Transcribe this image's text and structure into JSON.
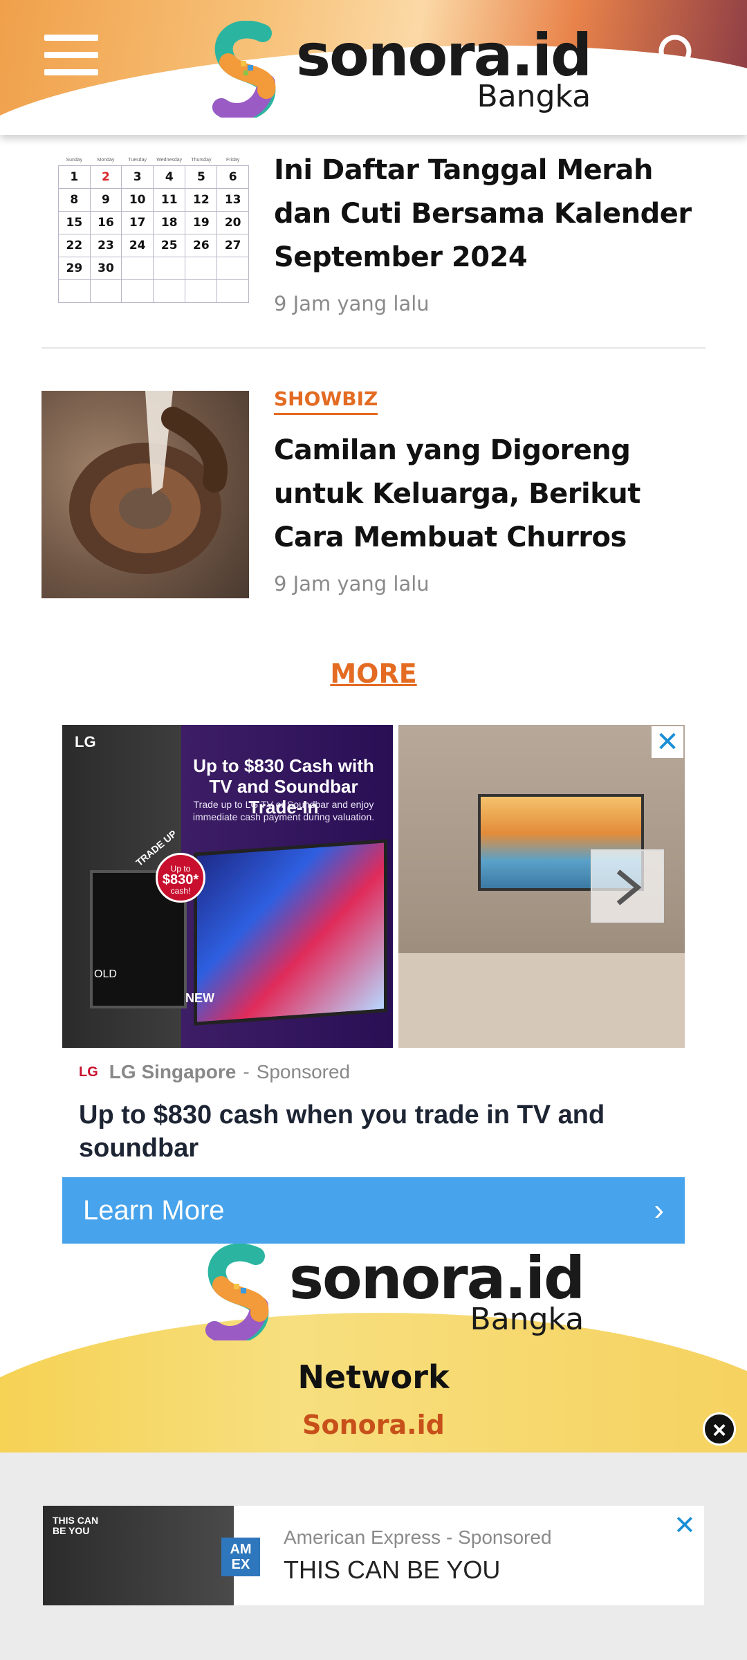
{
  "header": {
    "brand": "sonora.id",
    "city": "Bangka"
  },
  "articles": [
    {
      "category": "",
      "title": "Ini Daftar Tanggal Merah dan Cuti Bersama Kalender September 2024",
      "time": "9 Jam yang lalu"
    },
    {
      "category": "SHOWBIZ",
      "title": "Camilan yang Digoreng untuk Keluarga, Berikut Cara Membuat Churros",
      "time": "9 Jam yang lalu"
    }
  ],
  "calendar": {
    "rows": [
      [
        "1",
        "2",
        "3",
        "4",
        "5",
        "6"
      ],
      [
        "8",
        "9",
        "10",
        "11",
        "12",
        "13"
      ],
      [
        "15",
        "16",
        "17",
        "18",
        "19",
        "20"
      ],
      [
        "22",
        "23",
        "24",
        "25",
        "26",
        "27"
      ],
      [
        "29",
        "30",
        "",
        "",
        "",
        ""
      ],
      [
        "",
        "",
        "",
        "",
        "",
        ""
      ]
    ]
  },
  "more_label": "MORE",
  "ad": {
    "image_brand": "LG",
    "image_headline": "Up to $830 Cash with TV and Soundbar Trade-In",
    "image_sub": "Trade up to LG TV or Soundbar and enjoy immediate cash payment during valuation.",
    "badge_top": "Up to",
    "badge_value": "$830*",
    "badge_bottom": "cash!",
    "trade_up": "TRADE UP",
    "old_label": "OLD",
    "new_label": "NEW",
    "advertiser": "LG Singapore",
    "sponsored": "Sponsored",
    "title": "Up to $830 cash when you trade in TV and soundbar",
    "cta": "Learn More",
    "close": "✕"
  },
  "footer": {
    "brand": "sonora.id",
    "city": "Bangka",
    "network_label": "Network",
    "network_link": "Sonora.id"
  },
  "sticky_ad": {
    "image_text": "THIS CAN BE YOU",
    "logo_text": "AM EX",
    "advertiser": "American Express",
    "sponsored": "Sponsored",
    "title": "THIS CAN BE YOU",
    "close": "✕"
  }
}
